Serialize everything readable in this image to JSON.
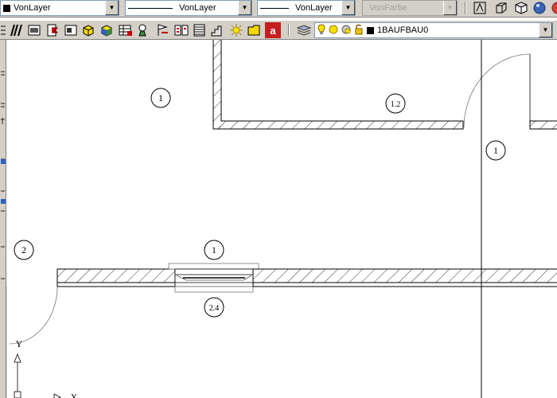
{
  "properties_toolbar": {
    "color": {
      "value": "VonLayer",
      "swatch": "#000000"
    },
    "linetype": {
      "value": "VonLayer"
    },
    "lineweight": {
      "value": "VonLayer"
    },
    "plotstyle": {
      "value": "VonFarbe",
      "disabled": true
    }
  },
  "layer_toolbar": {
    "current_layer": "1BAUFBAU0",
    "layer_state_icons": [
      "lightbulb-on-icon",
      "sun-thaw-icon",
      "viewport-freeze-icon",
      "padlock-unlocked-icon"
    ],
    "layer_color": "#000000"
  },
  "icons": {
    "props_right": [
      "mirror-text-icon",
      "box-3d-icon",
      "cube-outline-icon",
      "sphere-render-icon"
    ],
    "row2_tools": [
      "grid-dots-icon",
      "parallel-lines-icon",
      "text-style-icon",
      "block-attribute-icon",
      "image-insert-icon",
      "xref-icon",
      "cube-color-icon",
      "table-insert-icon",
      "light-bulb-user-icon",
      "flag-insert-icon",
      "schedule-icon",
      "notebook-icon",
      "stairs-icon",
      "sun-icon",
      "sheet-folder-icon",
      "autocad-a-icon"
    ],
    "layer_manager": "layers-stack-icon"
  },
  "drawing": {
    "callouts": [
      {
        "label": "1"
      },
      {
        "label": "1.2"
      },
      {
        "label": "1"
      },
      {
        "label": "2"
      },
      {
        "label": "1"
      },
      {
        "label": "2.4"
      }
    ],
    "ucs_axis": {
      "y": "Y",
      "x": "X"
    }
  }
}
